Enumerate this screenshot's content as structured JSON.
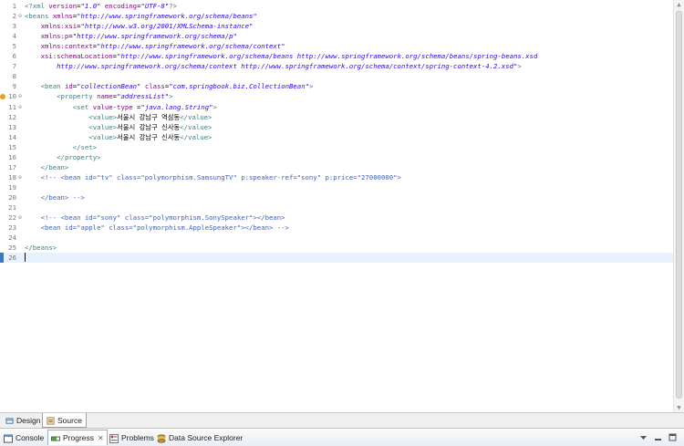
{
  "editor": {
    "current_line": 26,
    "lines": [
      {
        "n": "1",
        "fold": "",
        "mark": "",
        "tokens": [
          {
            "c": "t-pi",
            "t": "<?xml "
          },
          {
            "c": "t-attr",
            "t": "version"
          },
          {
            "c": "t-text",
            "t": "="
          },
          {
            "c": "t-val",
            "t": "\"1.0\""
          },
          {
            "c": "t-text",
            "t": " "
          },
          {
            "c": "t-attr",
            "t": "encoding"
          },
          {
            "c": "t-text",
            "t": "="
          },
          {
            "c": "t-val",
            "t": "\"UTF-8\""
          },
          {
            "c": "t-pi",
            "t": "?>"
          }
        ]
      },
      {
        "n": "2",
        "fold": "⊖",
        "mark": "",
        "tokens": [
          {
            "c": "t-tag",
            "t": "<beans "
          },
          {
            "c": "t-attr",
            "t": "xmlns"
          },
          {
            "c": "t-text",
            "t": "="
          },
          {
            "c": "t-val",
            "t": "\"http://www.springframework.org/schema/beans\""
          }
        ]
      },
      {
        "n": "3",
        "fold": "",
        "mark": "",
        "tokens": [
          {
            "c": "t-text",
            "t": "    "
          },
          {
            "c": "t-attr",
            "t": "xmlns:xsi"
          },
          {
            "c": "t-text",
            "t": "="
          },
          {
            "c": "t-val",
            "t": "\"http://www.w3.org/2001/XMLSchema-instance\""
          }
        ]
      },
      {
        "n": "4",
        "fold": "",
        "mark": "",
        "tokens": [
          {
            "c": "t-text",
            "t": "    "
          },
          {
            "c": "t-attr",
            "t": "xmlns:p"
          },
          {
            "c": "t-text",
            "t": "="
          },
          {
            "c": "t-val",
            "t": "\"http://www.springframework.org/schema/p\""
          }
        ]
      },
      {
        "n": "5",
        "fold": "",
        "mark": "",
        "tokens": [
          {
            "c": "t-text",
            "t": "    "
          },
          {
            "c": "t-attr",
            "t": "xmlns:context"
          },
          {
            "c": "t-text",
            "t": "="
          },
          {
            "c": "t-val",
            "t": "\"http://www.springframework.org/schema/context\""
          }
        ]
      },
      {
        "n": "6",
        "fold": "",
        "mark": "",
        "tokens": [
          {
            "c": "t-text",
            "t": "    "
          },
          {
            "c": "t-attr",
            "t": "xsi:schemaLocation"
          },
          {
            "c": "t-text",
            "t": "="
          },
          {
            "c": "t-val",
            "t": "\"http://www.springframework.org/schema/beans http://www.springframework.org/schema/beans/spring-beans.xsd"
          }
        ]
      },
      {
        "n": "7",
        "fold": "",
        "mark": "",
        "tokens": [
          {
            "c": "t-val",
            "t": "        http://www.springframework.org/schema/context http://www.springframework.org/schema/context/spring-context-4.2.xsd\""
          },
          {
            "c": "t-tag",
            "t": ">"
          }
        ]
      },
      {
        "n": "8",
        "fold": "",
        "mark": "",
        "tokens": []
      },
      {
        "n": "9",
        "fold": "",
        "mark": "",
        "tokens": [
          {
            "c": "t-text",
            "t": "    "
          },
          {
            "c": "t-tag",
            "t": "<bean "
          },
          {
            "c": "t-attr",
            "t": "id"
          },
          {
            "c": "t-text",
            "t": "="
          },
          {
            "c": "t-val",
            "t": "\"collectionBean\""
          },
          {
            "c": "t-text",
            "t": " "
          },
          {
            "c": "t-attr",
            "t": "class"
          },
          {
            "c": "t-text",
            "t": "="
          },
          {
            "c": "t-val",
            "t": "\"com.springbook.biz.CollectionBean\""
          },
          {
            "c": "t-tag",
            "t": ">"
          }
        ]
      },
      {
        "n": "10",
        "fold": "⊖",
        "mark": "#e0a020",
        "tokens": [
          {
            "c": "t-text",
            "t": "        "
          },
          {
            "c": "t-tag",
            "t": "<property "
          },
          {
            "c": "t-attr",
            "t": "name"
          },
          {
            "c": "t-text",
            "t": "="
          },
          {
            "c": "t-val",
            "t": "\"addressList\""
          },
          {
            "c": "t-tag",
            "t": ">"
          }
        ]
      },
      {
        "n": "11",
        "fold": "⊖",
        "mark": "",
        "tokens": [
          {
            "c": "t-text",
            "t": "            "
          },
          {
            "c": "t-tag",
            "t": "<set "
          },
          {
            "c": "t-attr",
            "t": "value-type "
          },
          {
            "c": "t-text",
            "t": "="
          },
          {
            "c": "t-val",
            "t": "\"java.lang.String\""
          },
          {
            "c": "t-tag",
            "t": ">"
          }
        ]
      },
      {
        "n": "12",
        "fold": "",
        "mark": "",
        "tokens": [
          {
            "c": "t-text",
            "t": "                "
          },
          {
            "c": "t-tag",
            "t": "<value>"
          },
          {
            "c": "t-text",
            "t": "서울시 강남구 역삼동"
          },
          {
            "c": "t-tag",
            "t": "</value>"
          }
        ]
      },
      {
        "n": "13",
        "fold": "",
        "mark": "",
        "tokens": [
          {
            "c": "t-text",
            "t": "                "
          },
          {
            "c": "t-tag",
            "t": "<value>"
          },
          {
            "c": "t-text",
            "t": "서울시 강남구 신사동"
          },
          {
            "c": "t-tag",
            "t": "</value>"
          }
        ]
      },
      {
        "n": "14",
        "fold": "",
        "mark": "",
        "tokens": [
          {
            "c": "t-text",
            "t": "                "
          },
          {
            "c": "t-tag",
            "t": "<value>"
          },
          {
            "c": "t-text",
            "t": "서울시 강남구 신사동"
          },
          {
            "c": "t-tag",
            "t": "</value>"
          }
        ]
      },
      {
        "n": "15",
        "fold": "",
        "mark": "",
        "tokens": [
          {
            "c": "t-text",
            "t": "            "
          },
          {
            "c": "t-tag",
            "t": "</set>"
          }
        ]
      },
      {
        "n": "16",
        "fold": "",
        "mark": "",
        "tokens": [
          {
            "c": "t-text",
            "t": "        "
          },
          {
            "c": "t-tag",
            "t": "</property>"
          }
        ]
      },
      {
        "n": "17",
        "fold": "",
        "mark": "",
        "tokens": [
          {
            "c": "t-text",
            "t": "    "
          },
          {
            "c": "t-tag",
            "t": "</bean>"
          }
        ]
      },
      {
        "n": "18",
        "fold": "⊖",
        "mark": "",
        "tokens": [
          {
            "c": "t-comment",
            "t": "    <!-- <bean id=\"tv\" class=\"polymorphism.SamsungTV\" p:speaker-ref=\"sony\" p:price=\"27000000\">"
          }
        ]
      },
      {
        "n": "19",
        "fold": "",
        "mark": "",
        "tokens": []
      },
      {
        "n": "20",
        "fold": "",
        "mark": "",
        "tokens": [
          {
            "c": "t-comment",
            "t": "    </bean> -->"
          }
        ]
      },
      {
        "n": "21",
        "fold": "",
        "mark": "",
        "tokens": []
      },
      {
        "n": "22",
        "fold": "⊖",
        "mark": "",
        "tokens": [
          {
            "c": "t-comment",
            "t": "    <!-- <bean id=\"sony\" class=\"polymorphism.SonySpeaker\"></bean>"
          }
        ]
      },
      {
        "n": "23",
        "fold": "",
        "mark": "",
        "tokens": [
          {
            "c": "t-comment",
            "t": "    <bean id=\"apple\" class=\"polymorphism.AppleSpeaker\"></bean> -->"
          }
        ]
      },
      {
        "n": "24",
        "fold": "",
        "mark": "",
        "tokens": []
      },
      {
        "n": "25",
        "fold": "",
        "mark": "",
        "tokens": [
          {
            "c": "t-tag",
            "t": "</beans>"
          }
        ]
      },
      {
        "n": "26",
        "fold": "",
        "mark": "#3a78c8",
        "tokens": []
      }
    ]
  },
  "editor_tabs": [
    {
      "label": "Design",
      "icon": "design-view-icon",
      "active": false
    },
    {
      "label": "Source",
      "icon": "source-view-icon",
      "active": true
    }
  ],
  "views": [
    {
      "label": "Console",
      "icon": "console-icon",
      "active": false,
      "closable": false
    },
    {
      "label": "Progress",
      "icon": "progress-icon",
      "active": true,
      "closable": true
    },
    {
      "label": "Problems",
      "icon": "problems-icon",
      "active": false,
      "closable": false
    },
    {
      "label": "Data Source Explorer",
      "icon": "data-source-explorer-icon",
      "active": false,
      "closable": false
    }
  ],
  "colors": {
    "accent": "#3a78c8",
    "current_line": "#e8f2fe",
    "tag": "#3f7f7f",
    "attr": "#7f007f",
    "value": "#2a00ff",
    "comment": "#3f5fbf"
  }
}
